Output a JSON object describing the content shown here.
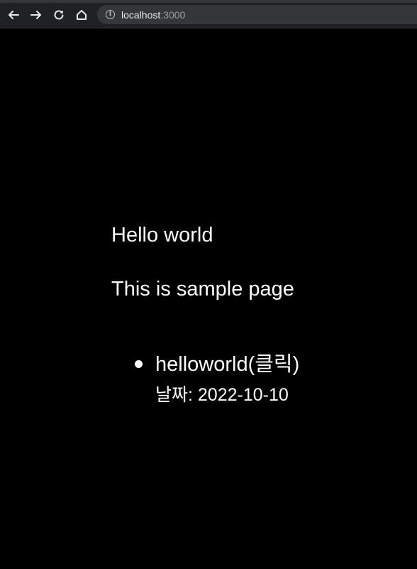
{
  "browser": {
    "url_host": "localhost",
    "url_port": ":3000",
    "icons": [
      "back-arrow-icon",
      "forward-arrow-icon",
      "reload-icon",
      "home-icon",
      "info-icon"
    ]
  },
  "page": {
    "heading": "Hello world",
    "subheading": "This is sample page",
    "posts": [
      {
        "title": "helloworld(클릭)",
        "date": "날짜: 2022-10-10"
      }
    ]
  },
  "colors": {
    "background": "#000000",
    "text": "#ffffff",
    "toolbar": "#202124",
    "omnibox": "#35363a"
  }
}
